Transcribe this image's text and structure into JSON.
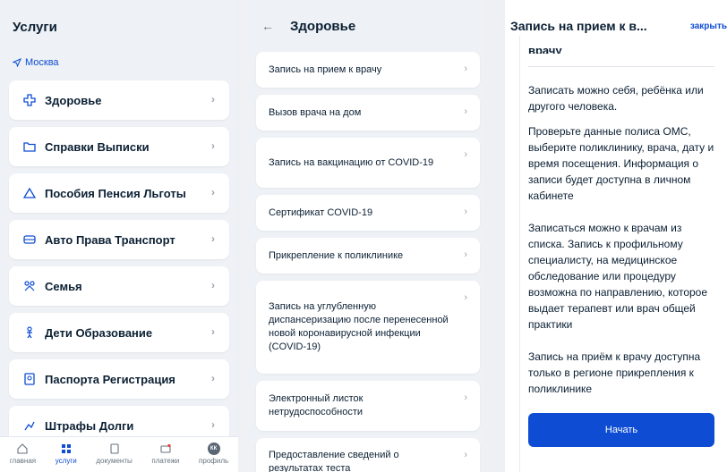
{
  "left": {
    "title": "Услуги",
    "location": "Москва",
    "services": [
      {
        "label": "Здоровье",
        "icon": "health-icon"
      },
      {
        "label": "Справки Выписки",
        "icon": "folder-icon"
      },
      {
        "label": "Пособия Пенсия Льготы",
        "icon": "house-icon"
      },
      {
        "label": "Авто Права Транспорт",
        "icon": "car-icon"
      },
      {
        "label": "Семья",
        "icon": "family-icon"
      },
      {
        "label": "Дети Образование",
        "icon": "child-icon"
      },
      {
        "label": "Паспорта Регистрация",
        "icon": "passport-icon"
      },
      {
        "label": "Штрафы Долги",
        "icon": "fines-icon"
      }
    ],
    "tabs": [
      {
        "label": "главная",
        "active": false
      },
      {
        "label": "услуги",
        "active": true
      },
      {
        "label": "документы",
        "active": false
      },
      {
        "label": "платежи",
        "active": false
      },
      {
        "label": "профиль",
        "active": false
      }
    ],
    "avatar_initials": "КК"
  },
  "middle": {
    "title": "Здоровье",
    "items": [
      "Запись на прием к врачу",
      "Вызов врача на дом",
      "Запись на вакцинацию от COVID-19",
      "Сертификат COVID-19",
      "Прикрепление к поликлинике",
      "Запись на углубленную диспансеризацию после перенесенной новой коронавирусной инфекции (COVID-19)",
      "Электронный листок нетрудоспособности",
      "Предоставление сведений о результатах теста"
    ]
  },
  "right": {
    "title": "Запись на прием к в...",
    "close_label": "закрыть",
    "cut_heading": "врачу",
    "paragraphs": [
      "Записать можно себя, ребёнка или другого человека.",
      "Проверьте данные полиса ОМС, выберите поликлинику, врача, дату и время посещения. Информация о записи будет доступна в личном кабинете",
      "Записаться можно к врачам из списка. Запись к профильному специалисту, на медицинское обследование или процедуру возможна по направлению, которое выдает терапевт или врач общей практики",
      "Запись на приём к врачу доступна только в регионе прикрепления к поликлинике"
    ],
    "start_label": "Начать"
  },
  "colors": {
    "accent": "#0d4cd3",
    "background": "#eef1f5",
    "text": "#0b1f33"
  }
}
